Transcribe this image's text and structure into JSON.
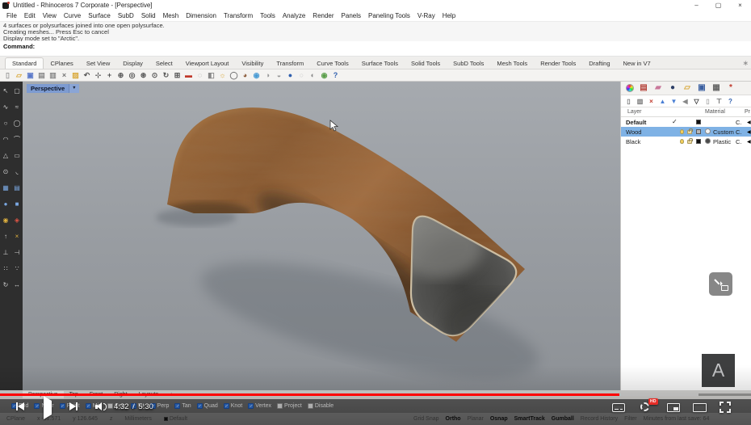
{
  "window": {
    "title": "Untitled - Rhinoceros 7 Corporate - [Perspective]",
    "minimize": "–",
    "maximize": "▢",
    "close": "×"
  },
  "menu": {
    "items": [
      "File",
      "Edit",
      "View",
      "Curve",
      "Surface",
      "SubD",
      "Solid",
      "Mesh",
      "Dimension",
      "Transform",
      "Tools",
      "Analyze",
      "Render",
      "Panels",
      "Paneling Tools",
      "V-Ray",
      "Help"
    ]
  },
  "command": {
    "history": [
      "4 surfaces or polysurfaces joined into one open polysurface.",
      "Creating meshes... Press Esc to cancel",
      "Display mode set to \"Arctic\"."
    ],
    "prompt_label": "Command:"
  },
  "toolbar_tabs": {
    "active": "Standard",
    "tabs": [
      "Standard",
      "CPlanes",
      "Set View",
      "Display",
      "Select",
      "Viewport Layout",
      "Visibility",
      "Transform",
      "Curve Tools",
      "Surface Tools",
      "Solid Tools",
      "SubD Tools",
      "Mesh Tools",
      "Render Tools",
      "Drafting",
      "New in V7"
    ],
    "options_gear": "∗"
  },
  "standard_toolbar": {
    "icons": [
      {
        "name": "new-file",
        "glyph": "▯",
        "color": "#9a9a9a"
      },
      {
        "name": "open-file",
        "glyph": "▱",
        "color": "#d9a93c"
      },
      {
        "name": "save",
        "glyph": "▣",
        "color": "#5b79c9"
      },
      {
        "name": "print",
        "glyph": "▤",
        "color": "#8a8a8a"
      },
      {
        "name": "copy",
        "glyph": "▥",
        "color": "#8a8a8a"
      },
      {
        "name": "cut",
        "glyph": "×",
        "color": "#777777"
      },
      {
        "name": "paste",
        "glyph": "▨",
        "color": "#d9a93c"
      },
      {
        "name": "undo",
        "glyph": "↶",
        "color": "#555555"
      },
      {
        "name": "pan",
        "glyph": "⊹",
        "color": "#555555"
      },
      {
        "name": "move",
        "glyph": "+",
        "color": "#555555"
      },
      {
        "name": "zoom-dynamic",
        "glyph": "⊕",
        "color": "#555555"
      },
      {
        "name": "zoom-window",
        "glyph": "◎",
        "color": "#555555"
      },
      {
        "name": "zoom-extents",
        "glyph": "⊛",
        "color": "#555555"
      },
      {
        "name": "zoom-selected",
        "glyph": "⊙",
        "color": "#555555"
      },
      {
        "name": "rotate-view",
        "glyph": "↻",
        "color": "#555555"
      },
      {
        "name": "viewport-layout",
        "glyph": "⊞",
        "color": "#555555"
      },
      {
        "name": "undo-view-change",
        "glyph": "▬",
        "color": "#c0392b"
      },
      {
        "name": "hide-objects",
        "glyph": "◌",
        "color": "#888888"
      },
      {
        "name": "lock-objects",
        "glyph": "◧",
        "color": "#888888"
      },
      {
        "name": "lamp",
        "glyph": "☼",
        "color": "#d9a93c"
      },
      {
        "name": "wireframe-display",
        "glyph": "◯",
        "color": "#777777"
      },
      {
        "name": "shaded-display",
        "glyph": "◕",
        "color": "#8a5a3a"
      },
      {
        "name": "rendered-display",
        "glyph": "◉",
        "color": "#4a9bd4"
      },
      {
        "name": "ghosted-display",
        "glyph": "◑",
        "color": "#999999"
      },
      {
        "name": "xray-display",
        "glyph": "◒",
        "color": "#999999"
      },
      {
        "name": "raytraced-display",
        "glyph": "●",
        "color": "#2f5fae"
      },
      {
        "name": "arctic-display",
        "glyph": "○",
        "color": "#cccccc"
      },
      {
        "name": "flat-shade",
        "glyph": "◐",
        "color": "#888888"
      },
      {
        "name": "render",
        "glyph": "◉",
        "color": "#5a9e4a"
      },
      {
        "name": "help",
        "glyph": "?",
        "color": "#2f5fae"
      }
    ]
  },
  "sidebar": {
    "tools": [
      {
        "name": "select",
        "glyph": "↖",
        "color": "#d0d0d0"
      },
      {
        "name": "lasso-select",
        "glyph": "▢",
        "color": "#d0d0d0"
      },
      {
        "name": "polyline",
        "glyph": "∿",
        "color": "#d0d0d0"
      },
      {
        "name": "control-point-curve",
        "glyph": "≈",
        "color": "#d0d0d0"
      },
      {
        "name": "circle",
        "glyph": "○",
        "color": "#d0d0d0"
      },
      {
        "name": "ellipse",
        "glyph": "◯",
        "color": "#d0d0d0"
      },
      {
        "name": "arc",
        "glyph": "◠",
        "color": "#d0d0d0"
      },
      {
        "name": "conic",
        "glyph": "⌒",
        "color": "#d0d0d0"
      },
      {
        "name": "polygon",
        "glyph": "△",
        "color": "#d0d0d0"
      },
      {
        "name": "rectangle",
        "glyph": "▭",
        "color": "#d0d0d0"
      },
      {
        "name": "center-circle",
        "glyph": "⊙",
        "color": "#d0d0d0"
      },
      {
        "name": "fillet-curve",
        "glyph": "◟",
        "color": "#d0d0d0"
      },
      {
        "name": "surface-from-curves",
        "glyph": "▦",
        "color": "#7aa7e0"
      },
      {
        "name": "loft-surface",
        "glyph": "▤",
        "color": "#7aa7e0"
      },
      {
        "name": "sphere",
        "glyph": "●",
        "color": "#7aa7e0"
      },
      {
        "name": "box",
        "glyph": "■",
        "color": "#7aa7e0"
      },
      {
        "name": "boolean-union",
        "glyph": "◉",
        "color": "#e0b13f"
      },
      {
        "name": "fillet-edge",
        "glyph": "◈",
        "color": "#e05545"
      },
      {
        "name": "extrude",
        "glyph": "↑",
        "color": "#d0d0d0"
      },
      {
        "name": "explode",
        "glyph": "×",
        "color": "#e0b13f"
      },
      {
        "name": "join",
        "glyph": "⊥",
        "color": "#d0d0d0"
      },
      {
        "name": "trim",
        "glyph": "⊣",
        "color": "#d0d0d0"
      },
      {
        "name": "point-cloud",
        "glyph": "∷",
        "color": "#d0d0d0"
      },
      {
        "name": "point",
        "glyph": "∵",
        "color": "#d0d0d0"
      },
      {
        "name": "rotate",
        "glyph": "↻",
        "color": "#d0d0d0"
      },
      {
        "name": "scale",
        "glyph": "↔",
        "color": "#d0d0d0"
      }
    ]
  },
  "viewport": {
    "label": "Perspective",
    "dropdown": "▼"
  },
  "viewport_tabs": {
    "active": "Perspective",
    "tabs": [
      "Perspective",
      "Top",
      "Front",
      "Right",
      "Layouts",
      "+"
    ]
  },
  "layers_panel": {
    "panel_tabs": [
      {
        "name": "properties",
        "glyph": ""
      },
      {
        "name": "layers",
        "glyph": "▤",
        "color": "#b5433a"
      },
      {
        "name": "display",
        "glyph": "▰",
        "color": "#c9789a"
      },
      {
        "name": "rendering",
        "glyph": "●",
        "color": "#2c3e66"
      },
      {
        "name": "libraries",
        "glyph": "▱",
        "color": "#d9a93c"
      },
      {
        "name": "web-browser",
        "glyph": "▣",
        "color": "#3b5fa0"
      },
      {
        "name": "named-views",
        "glyph": "▦",
        "color": "#666666"
      },
      {
        "name": "v-ray",
        "glyph": "*",
        "color": "#c0392b"
      }
    ],
    "layer_toolbar": [
      {
        "name": "new-layer",
        "glyph": "▯",
        "color": "#777777"
      },
      {
        "name": "new-sublayer",
        "glyph": "▥",
        "color": "#777777"
      },
      {
        "name": "delete-layer",
        "glyph": "×",
        "color": "#c0392b"
      },
      {
        "name": "move-up",
        "glyph": "▲",
        "color": "#4a7fd4"
      },
      {
        "name": "move-down",
        "glyph": "▼",
        "color": "#4a7fd4"
      },
      {
        "name": "collapse",
        "glyph": "◀",
        "color": "#888888"
      },
      {
        "name": "filter",
        "glyph": "▽",
        "color": "#333333"
      },
      {
        "name": "select-layer-objects",
        "glyph": "▯",
        "color": "#aaaaaa"
      },
      {
        "name": "layer-tools",
        "glyph": "⊤",
        "color": "#555555"
      },
      {
        "name": "help",
        "glyph": "?",
        "color": "#2f5fae"
      }
    ],
    "columns": [
      "Layer",
      "Material",
      "Pr"
    ],
    "rows": [
      {
        "name": "Default",
        "current": "✓",
        "swatch": "#111111",
        "material": "",
        "linetype": "C.",
        "state": "bold",
        "arrow": "◀"
      },
      {
        "name": "Wood",
        "current": "",
        "swatch": "#b8b8b8",
        "mat_color": "#f5f5f5",
        "material": "Custom",
        "linetype": "C.",
        "state": "selected",
        "arrow": "◀"
      },
      {
        "name": "Black",
        "current": "",
        "swatch": "#111111",
        "mat_color": "#4a4a4a",
        "material": "Plastic",
        "linetype": "C.",
        "state": "normal",
        "arrow": "◀"
      }
    ]
  },
  "osnap": {
    "items": [
      {
        "label": "End",
        "state": "on",
        "check": "✓"
      },
      {
        "label": "Near",
        "state": "on",
        "check": "✓"
      },
      {
        "label": "Point",
        "state": "on",
        "check": "✓"
      },
      {
        "label": "Mid",
        "state": "on",
        "check": "✓"
      },
      {
        "label": "Cen",
        "state": "off",
        "check": ""
      },
      {
        "label": "Int",
        "state": "on",
        "check": "✓"
      },
      {
        "label": "Perp",
        "state": "on",
        "check": "✓"
      },
      {
        "label": "Tan",
        "state": "on",
        "check": "✓"
      },
      {
        "label": "Quad",
        "state": "on",
        "check": "✓"
      },
      {
        "label": "Knot",
        "state": "on",
        "check": "✓"
      },
      {
        "label": "Vertex",
        "state": "on",
        "check": "✓"
      },
      {
        "label": "Project",
        "state": "off",
        "check": ""
      },
      {
        "label": "Disable",
        "state": "off",
        "check": ""
      }
    ]
  },
  "status_bar": {
    "left": [
      {
        "label": "CPlane",
        "state": "normal"
      },
      {
        "label": "x -61.571",
        "state": "normal"
      },
      {
        "label": "y 126.645",
        "state": "normal"
      },
      {
        "label": "z",
        "state": "normal"
      },
      {
        "label": "Millimeters",
        "state": "normal"
      },
      {
        "label": "Default",
        "state": "normal",
        "swatch": "#111111"
      }
    ],
    "right": [
      {
        "label": "Grid Snap",
        "state": "normal"
      },
      {
        "label": "Ortho",
        "state": "active"
      },
      {
        "label": "Planar",
        "state": "normal"
      },
      {
        "label": "Osnap",
        "state": "active"
      },
      {
        "label": "SmartTrack",
        "state": "active"
      },
      {
        "label": "Gumball",
        "state": "active"
      },
      {
        "label": "Record History",
        "state": "normal"
      },
      {
        "label": "Filter",
        "state": "normal"
      },
      {
        "label": "Minutes from last save: 64",
        "state": "normal"
      }
    ]
  },
  "video_player": {
    "time_current": "4:32",
    "time_separator": " / ",
    "time_total": "5:30",
    "progress_width": "82.5%",
    "buffer_width": "93%",
    "settings_badge": "HD",
    "watermark_letter": "A"
  },
  "colors": {
    "progress_red": "#ff0000",
    "selection_blue": "#7fb2e5",
    "osnap_check_blue": "#2f6fce",
    "viewport_gray_top": "#a6aaaf",
    "viewport_gray_bottom": "#8d9196",
    "wood_brown": "#96653a",
    "hd_badge_red": "#e52d27"
  }
}
